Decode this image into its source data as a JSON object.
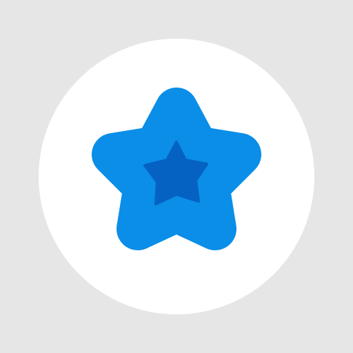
{
  "icon": {
    "name": "star-icon",
    "colors": {
      "background": "#e6e6e6",
      "badge": "#ffffff",
      "star_outer": "#0a8ee8",
      "star_inner": "#0562c2"
    }
  }
}
